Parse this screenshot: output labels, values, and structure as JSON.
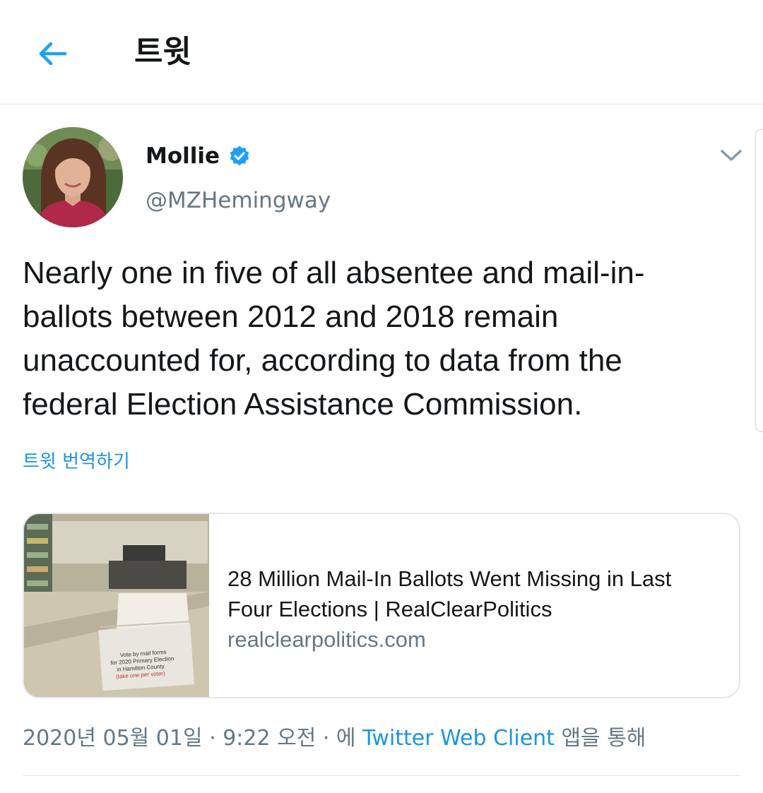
{
  "header": {
    "title": "트윗"
  },
  "tweet": {
    "display_name": "Mollie",
    "handle": "@MZHemingway",
    "text": "Nearly one in five of all absentee and mail-in-\nballots between 2012 and 2018 remain\nunaccounted for, according to data from the\nfederal Election Assistance Commission.",
    "translate_label": "트윗 번역하기"
  },
  "card": {
    "title": "28 Million Mail-In Ballots Went Missing in Last Four Elections | RealClearPolitics",
    "domain": "realclearpolitics.com",
    "image_box_text": [
      "Vote by mail forms",
      "for 2020 Primary Election",
      "in Hamilton County",
      "(take one per voter)"
    ]
  },
  "meta": {
    "date": "2020년 05월 01일",
    "sep1": " · ",
    "time": "9:22 오전",
    "sep2": " · ",
    "via_prefix": "에 ",
    "client": "Twitter Web Client",
    "via_suffix": " 앱을 통해"
  },
  "colors": {
    "accent": "#1da1f2",
    "link": "#1b95e0",
    "secondary_text": "#657786",
    "border": "#e1e6ea"
  },
  "icons": {
    "back": "back-arrow-icon",
    "verified": "verified-badge-icon",
    "more": "chevron-down-icon"
  }
}
